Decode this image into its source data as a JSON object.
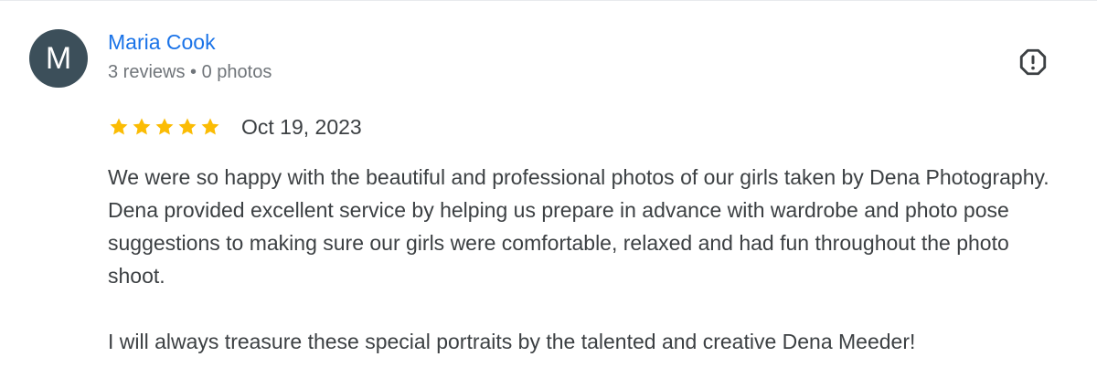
{
  "review": {
    "author": {
      "initial": "M",
      "name": "Maria Cook",
      "meta": "3 reviews • 0 photos",
      "avatar_color": "#3c4f5a"
    },
    "rating": {
      "stars": 5,
      "max": 5,
      "star_color": "#fbbc04"
    },
    "date": "Oct 19, 2023",
    "paragraphs": [
      "We were so happy with the beautiful and professional photos of our girls taken by Dena Photography. Dena provided excellent service by helping us prepare in advance with wardrobe and photo pose suggestions to making sure our girls were comfortable, relaxed and had fun throughout the photo shoot.",
      "I will always treasure these special portraits by the talented and creative Dena Meeder!"
    ],
    "report_icon": "report-flag-icon"
  },
  "colors": {
    "link": "#1a73e8",
    "text": "#3c4043",
    "meta": "#70757a"
  }
}
